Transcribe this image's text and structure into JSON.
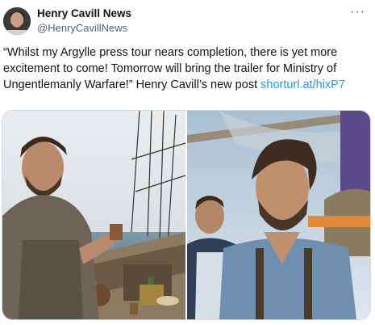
{
  "tweet": {
    "display_name": "Henry Cavill News",
    "handle": "@HenryCavillNews",
    "more_icon": "ellipsis-icon",
    "text": "“Whilst my Argylle press tour nears completion, there is yet more excitement to come! Tomorrow will bring the trailer for Ministry of Ungentlemanly Warfare!” Henry Cavill’s new post ",
    "link_text": "shorturl.at/hixP7"
  },
  "colors": {
    "link": "#1d9bf0",
    "secondary_text": "#536471",
    "border": "#cfd9de"
  }
}
